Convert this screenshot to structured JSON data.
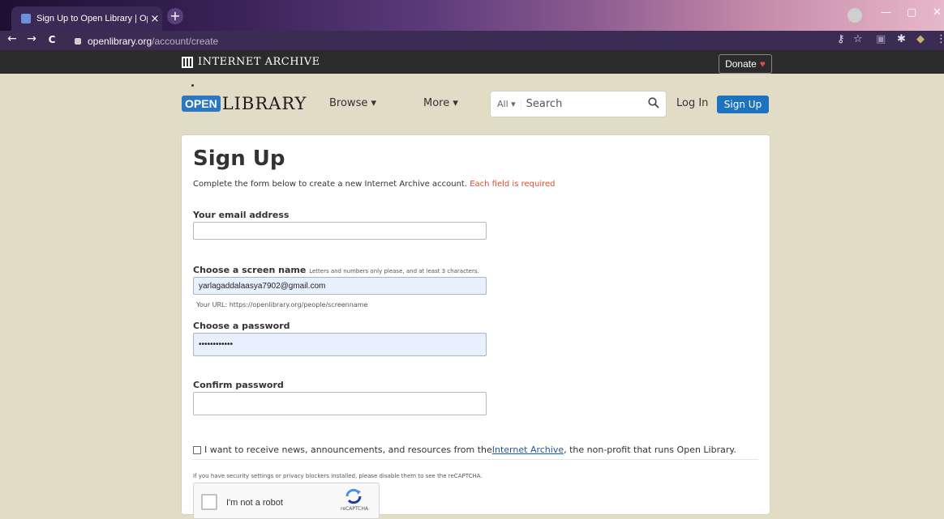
{
  "browser": {
    "tab_title": "Sign Up to Open Library | Open",
    "tab_close": "×",
    "new_tab": "+",
    "url_domain": "openlibrary.org",
    "url_path": "/account/create",
    "back": "←",
    "forward": "→",
    "reload": "C",
    "minimize": "—",
    "maximize": "▢",
    "close": "✕",
    "icons": [
      "key-icon",
      "star-icon",
      "extensions-icon",
      "puzzle-icon",
      "menu-icon"
    ]
  },
  "ia_bar": {
    "logo_text": "INTERNET ARCHIVE",
    "donate_label": "Donate",
    "donate_heart": "♥"
  },
  "header": {
    "logo_open": "OPEN",
    "logo_library": "LIBRARY",
    "browse_label": "Browse ▾",
    "more_label": "More ▾",
    "search_scope": "All ▾",
    "search_placeholder": "Search",
    "login_label": "Log In",
    "signup_label": "Sign Up"
  },
  "form": {
    "title": "Sign Up",
    "intro": "Complete the form below to create a new Internet Archive account.",
    "required_note": "Each field is required",
    "email_label": "Your email address",
    "email_value": "",
    "screenname_label": "Choose a screen name",
    "screenname_hint": "Letters and numbers only please, and at least 3 characters.",
    "screenname_value": "yarlagaddalaasya7902@gmail.com",
    "url_hint": "Your URL: https://openlibrary.org/people/screenname",
    "password_label": "Choose a password",
    "password_value": "••••••••••••",
    "confirm_label": "Confirm password",
    "confirm_value": "",
    "news_pre": "I want to receive news, announcements, and resources from the ",
    "news_link": "Internet Archive",
    "news_post": ", the non-profit that runs Open Library.",
    "news_checked": false,
    "security_note": "If you have security settings or privacy blockers installed, please disable them to see the reCAPTCHA.",
    "captcha_label": "I'm not a robot",
    "captcha_brand": "reCAPTCHA"
  },
  "colors": {
    "accent": "#1e73be",
    "required": "#e04a2a",
    "page_bg": "#e1dcc5"
  }
}
